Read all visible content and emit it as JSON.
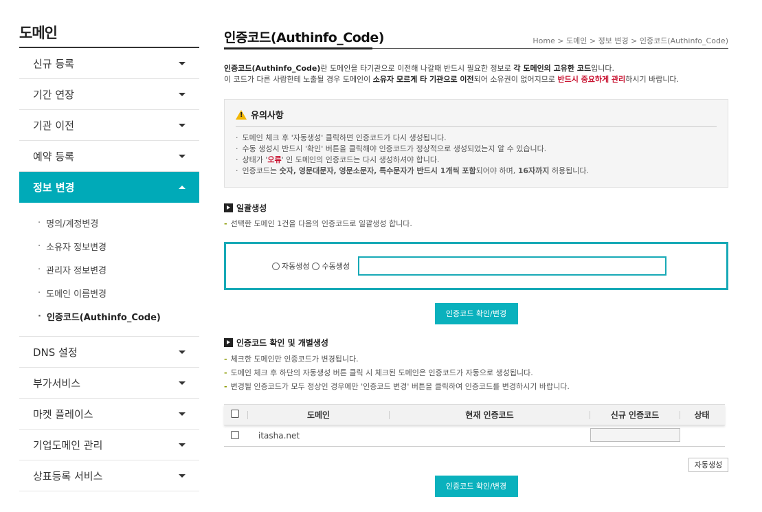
{
  "sidebar": {
    "title": "도메인",
    "items": [
      {
        "label": "신규 등록"
      },
      {
        "label": "기간 연장"
      },
      {
        "label": "기관 이전"
      },
      {
        "label": "예약 등록"
      },
      {
        "label": "정보 변경"
      },
      {
        "label": "DNS 설정"
      },
      {
        "label": "부가서비스"
      },
      {
        "label": "마켓 플레이스"
      },
      {
        "label": "기업도메인 관리"
      },
      {
        "label": "상표등록 서비스"
      }
    ],
    "submenu": [
      {
        "label": "명의/계정변경"
      },
      {
        "label": "소유자 정보변경"
      },
      {
        "label": "관리자 정보변경"
      },
      {
        "label": "도메인 이름변경"
      },
      {
        "label": "인증코드(Authinfo_Code)"
      }
    ]
  },
  "header": {
    "title": "인증코드(Authinfo_Code)",
    "breadcrumb": {
      "home": "Home",
      "sep": ">",
      "level1": "도메인",
      "level2": "정보 변경",
      "level3": "인증코드(Authinfo_Code)"
    }
  },
  "intro": {
    "l1a": "인증코드(Authinfo_Code)",
    "l1b": "란 도메인을 타기관으로 이전해 나갈때 반드시 필요한 정보로 ",
    "l1c": "각 도메인의 고유한 코드",
    "l1d": "입니다.",
    "l2a": "이 코드가 다른 사람한테 노출될 경우 도메인이 ",
    "l2b": "소유자 모르게 타 기관으로 이전",
    "l2c": "되어 소유권이 없어지므로 ",
    "l2d": "반드시 중요하게 관리",
    "l2e": "하시기 바랍니다."
  },
  "notice": {
    "title": "유의사항",
    "bullet": "·",
    "i1": "도메인 체크 후 '자동생성' 클릭하면 인증코드가 다시 생성됩니다.",
    "i2": "수동 생성시 반드시 '확인' 버튼을 클릭해야 인증코드가 정상적으로 생성되었는지 알 수 있습니다.",
    "i3a": "상태가 '",
    "i3b": "오류",
    "i3c": "' 인 도메인의 인증코드는 다시 생성하셔야 합니다.",
    "i4a": "인증코드는 ",
    "i4b": "숫자, 영문대문자, 영문소문자, 특수문자가 반드시 1개씩 포함",
    "i4c": "되어야 하며, ",
    "i4d": "16자까지",
    "i4e": " 허용됩니다."
  },
  "bulk": {
    "title": "일괄생성",
    "dash": "-",
    "desc": "선택한 도메인 1건을 다음의 인증코드로 일괄생성 합니다.",
    "auto": "자동생성",
    "manual": "수동생성",
    "button": "인증코드 확인/변경"
  },
  "individual": {
    "title": "인증코드 확인 및 개별생성",
    "d1": "체크한 도메인만 인증코드가 변경됩니다.",
    "d2": "도메인 체크 후 하단의 자동생성 버튼 클릭 시 체크된 도메인은 인증코드가 자동으로 생성됩니다.",
    "d3": "변경될 인증코드가 모두 정상인 경우에만 '인증코드 변경' 버튼을 클릭하여 인증코드를 변경하시기 바랍니다.",
    "columns": {
      "domain": "도메인",
      "current": "현재 인증코드",
      "new": "신규 인증코드",
      "status": "상태"
    },
    "rows": [
      {
        "domain": "itasha.net",
        "current": "",
        "status": ""
      }
    ],
    "auto_button": "자동생성",
    "button": "인증코드 확인/변경"
  },
  "colors": {
    "accent": "#00aab8",
    "warning": "#c8102e"
  }
}
